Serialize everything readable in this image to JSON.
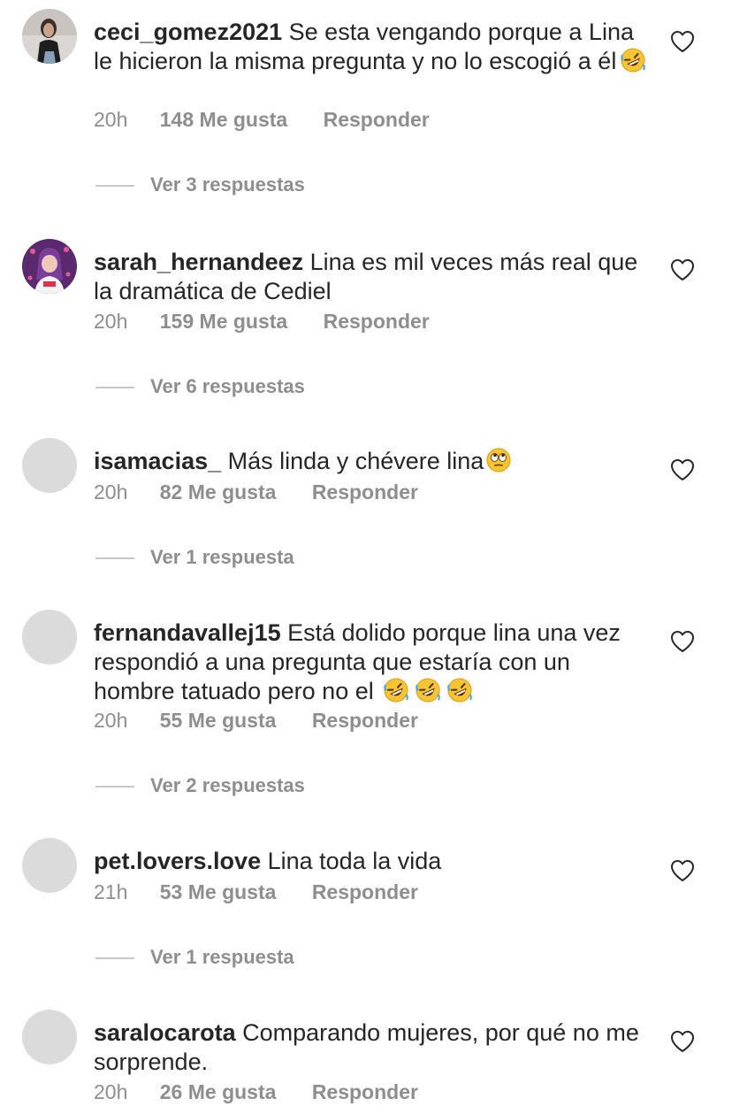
{
  "icons": {
    "like": "heart-outline-icon",
    "laugh_emoji": "rolling-on-floor-laughing-emoji",
    "eye_roll_emoji": "face-with-rolling-eyes-emoji"
  },
  "colors": {
    "text": "#262626",
    "secondary_text": "#8e8e8e",
    "avatar_placeholder": "#dbdbdb"
  },
  "comments": [
    {
      "username": "ceci_gomez2021",
      "text": "Se esta vengando porque a Lina le hicieron la misma pregunta y no lo escogió a él",
      "emojis": [
        "rolling-on-floor-laughing-emoji"
      ],
      "time": "20h",
      "likes": "148 Me gusta",
      "reply": "Responder",
      "view_replies": "Ver 3 respuestas"
    },
    {
      "username": "sarah_hernandeez",
      "text": "Lina es mil veces más real que la dramática de Cediel",
      "emojis": [],
      "time": "20h",
      "likes": "159 Me gusta",
      "reply": "Responder",
      "view_replies": "Ver 6 respuestas"
    },
    {
      "username": "isamacias_",
      "text": "Más linda y chévere lina",
      "emojis": [
        "face-with-rolling-eyes-emoji"
      ],
      "time": "20h",
      "likes": "82 Me gusta",
      "reply": "Responder",
      "view_replies": "Ver 1 respuesta"
    },
    {
      "username": "fernandavallej15",
      "text": "Está dolido porque lina una vez respondió a una pregunta que estaría con un hombre tatuado pero no el",
      "emojis": [
        "rolling-on-floor-laughing-emoji",
        "rolling-on-floor-laughing-emoji",
        "rolling-on-floor-laughing-emoji"
      ],
      "time": "20h",
      "likes": "55 Me gusta",
      "reply": "Responder",
      "view_replies": "Ver 2 respuestas"
    },
    {
      "username": "pet.lovers.love",
      "text": "Lina toda la vida",
      "emojis": [],
      "time": "21h",
      "likes": "53 Me gusta",
      "reply": "Responder",
      "view_replies": "Ver 1 respuesta"
    },
    {
      "username": "saralocarota",
      "text": "Comparando mujeres, por qué no me sorprende.",
      "emojis": [],
      "time": "20h",
      "likes": "26 Me gusta",
      "reply": "Responder",
      "view_replies": ""
    }
  ]
}
